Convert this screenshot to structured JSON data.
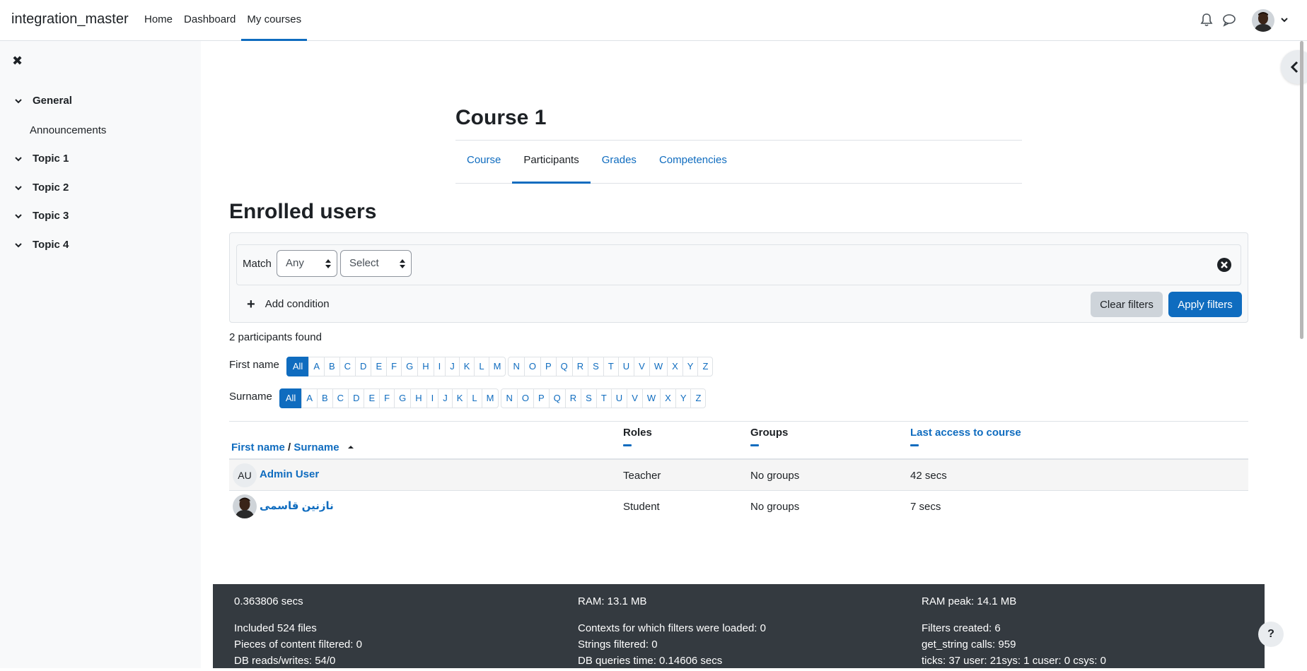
{
  "navbar": {
    "brand": "integration_master",
    "links": [
      {
        "label": "Home"
      },
      {
        "label": "Dashboard"
      },
      {
        "label": "My courses",
        "active": true
      }
    ],
    "icons": [
      "bell-icon",
      "chat-icon",
      "user-avatar",
      "chevron-down-icon"
    ]
  },
  "drawer": {
    "close_icon": "✖",
    "sections": [
      {
        "label": "General",
        "items": [
          "Announcements"
        ]
      },
      {
        "label": "Topic 1"
      },
      {
        "label": "Topic 2"
      },
      {
        "label": "Topic 3"
      },
      {
        "label": "Topic 4"
      }
    ]
  },
  "course": {
    "title": "Course 1",
    "tabs": [
      {
        "label": "Course"
      },
      {
        "label": "Participants",
        "active": true
      },
      {
        "label": "Grades"
      },
      {
        "label": "Competencies"
      }
    ]
  },
  "page": {
    "heading": "Enrolled users"
  },
  "filters": {
    "match_label": "Match",
    "match_value": "Any",
    "type_value": "Select",
    "add_condition": "Add condition",
    "clear_label": "Clear filters",
    "apply_label": "Apply filters"
  },
  "results": {
    "count_text": "2 participants found"
  },
  "initials": {
    "first_label": "First name",
    "surname_label": "Surname",
    "all_label": "All",
    "letters_a_m": [
      "A",
      "B",
      "C",
      "D",
      "E",
      "F",
      "G",
      "H",
      "I",
      "J",
      "K",
      "L",
      "M"
    ],
    "letters_n_z": [
      "N",
      "O",
      "P",
      "Q",
      "R",
      "S",
      "T",
      "U",
      "V",
      "W",
      "X",
      "Y",
      "Z"
    ]
  },
  "table": {
    "headers": {
      "firstname": "First name",
      "separator": "/",
      "surname": "Surname",
      "roles": "Roles",
      "groups": "Groups",
      "lastaccess": "Last access to course"
    },
    "rows": [
      {
        "initials": "AU",
        "name": "Admin User",
        "role": "Teacher",
        "groups": "No groups",
        "lastaccess": "42 secs"
      },
      {
        "initials": "",
        "name": "نازنین قاسمی",
        "role": "Student",
        "groups": "No groups",
        "lastaccess": "7 secs"
      }
    ]
  },
  "footer": {
    "col1": [
      "0.363806 secs",
      "Included 524 files",
      "Pieces of content filtered: 0",
      "DB reads/writes: 54/0"
    ],
    "col2": [
      "RAM: 13.1 MB",
      "Contexts for which filters were loaded: 0",
      "Strings filtered: 0",
      "DB queries time: 0.14606 secs"
    ],
    "col3": [
      "RAM peak: 14.1 MB",
      "Filters created: 6",
      "get_string calls: 959",
      "ticks: 37 user: 21sys: 1 cuser: 0 csys: 0"
    ]
  },
  "help_label": "?",
  "colors": {
    "primary": "#0f6cbf",
    "footer_bg": "#343a40",
    "drawer_bg": "#f8f9fa"
  }
}
